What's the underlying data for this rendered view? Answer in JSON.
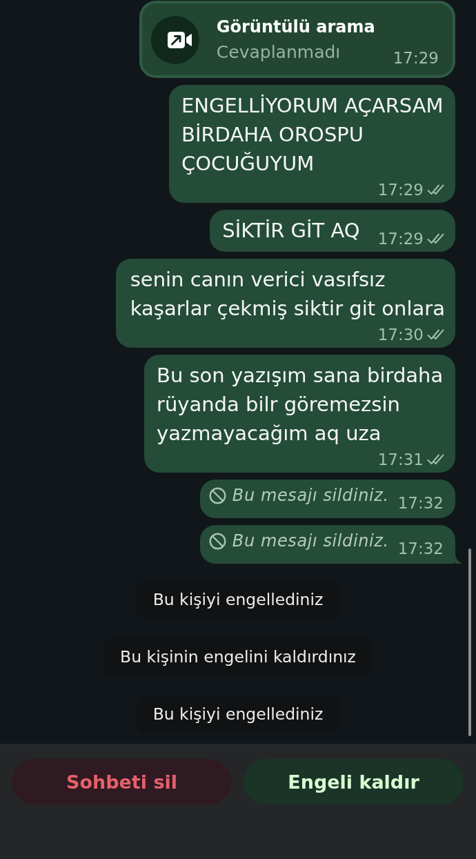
{
  "chat": {
    "messages": [
      {
        "kind": "call",
        "title": "Görüntülü arama",
        "subtitle": "Cevaplanmadı",
        "time": "17:29",
        "tail": false
      },
      {
        "kind": "text",
        "text": "ENGELLİYORUM AÇARSAM BİRDAHA OROSPU ÇOCUĞUYUM",
        "time": "17:29",
        "read": false,
        "tail": false
      },
      {
        "kind": "text",
        "text": "SİKTİR GİT AQ",
        "time": "17:29",
        "read": false,
        "tail": false
      },
      {
        "kind": "text",
        "text": "senin canın verici vasıfsız\nkaşarlar çekmiş siktir git onlara",
        "time": "17:30",
        "read": false,
        "tail": false
      },
      {
        "kind": "text",
        "text": "Bu son yazışım sana birdaha rüyanda bilr göremezsin yazmayacağım aq uza",
        "time": "17:31",
        "read": false,
        "tail": false
      },
      {
        "kind": "deleted",
        "text": "Bu mesajı sildiniz.",
        "time": "17:32",
        "tail": false
      },
      {
        "kind": "deleted",
        "text": "Bu mesajı sildiniz.",
        "time": "17:32",
        "tail": true
      }
    ],
    "notices": [
      "Bu kişiyi engellediniz",
      "Bu kişinin engelini kaldırdınız",
      "Bu kişiyi engellediniz"
    ]
  },
  "actions": [
    {
      "label": "Sohbeti sil",
      "kind": "destructive"
    },
    {
      "label": "Engeli kaldır",
      "kind": "primary"
    }
  ]
}
